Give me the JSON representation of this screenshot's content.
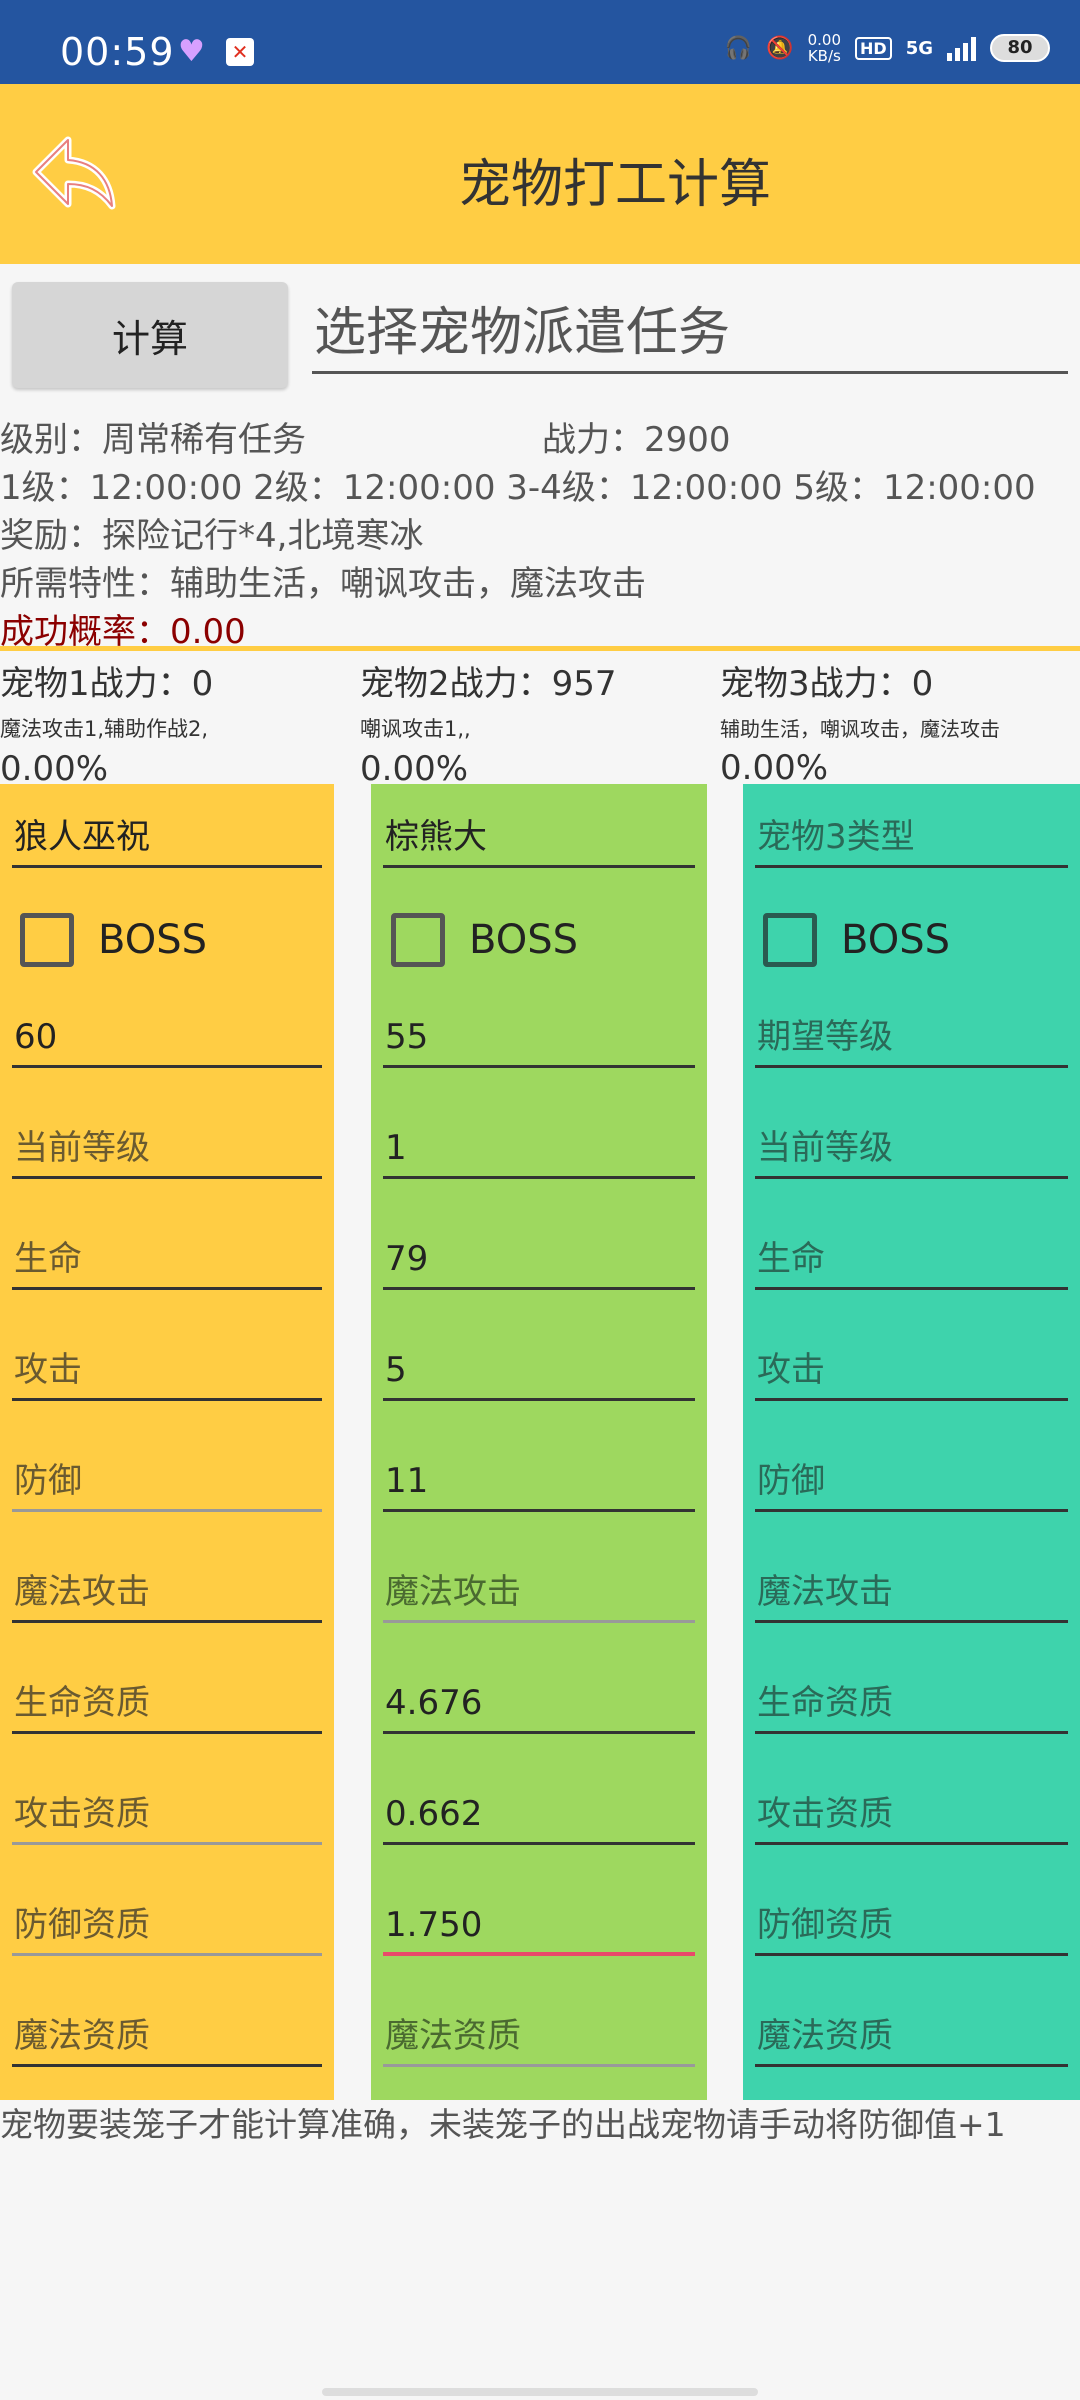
{
  "status": {
    "time": "00:59",
    "net_speed": "0.00",
    "net_unit": "KB/s",
    "hd": "HD",
    "signal": "5G",
    "battery": "80"
  },
  "header": {
    "title": "宠物打工计算"
  },
  "controls": {
    "calc_label": "计算",
    "task_select": "选择宠物派遣任务"
  },
  "info": {
    "level": "级别：周常稀有任务",
    "power": "战力：2900",
    "durations": "1级：12:00:00 2级：12:00:00 3-4级：12:00:00  5级：12:00:00",
    "reward": "奖励：探险记行*4,北境寒冰",
    "traits": "所需特性：辅助生活，嘲讽攻击，魔法攻击",
    "success_label": "成功概率：",
    "success_value": "0.00"
  },
  "pets": [
    {
      "power": "宠物1战力：0",
      "traits": "魔法攻击1,辅助作战2,",
      "pct": "0.00%"
    },
    {
      "power": "宠物2战力：957",
      "traits": "嘲讽攻击1,,",
      "pct": "0.00%"
    },
    {
      "power": "宠物3战力：0",
      "traits": "辅助生活，嘲讽攻击，魔法攻击",
      "pct": "0.00%"
    }
  ],
  "columns": [
    {
      "type": "狼人巫祝",
      "boss_label": "BOSS",
      "fields": [
        "60",
        "当前等级",
        "生命",
        "攻击",
        "防御",
        "魔法攻击",
        "生命资质",
        "攻击资质",
        "防御资质",
        "魔法资质"
      ]
    },
    {
      "type": "棕熊大",
      "boss_label": "BOSS",
      "fields": [
        "55",
        "1",
        "79",
        "5",
        "11",
        "魔法攻击",
        "4.676",
        "0.662",
        "1.750",
        "魔法资质"
      ]
    },
    {
      "type": "宠物3类型",
      "boss_label": "BOSS",
      "fields": [
        "期望等级",
        "当前等级",
        "生命",
        "攻击",
        "防御",
        "魔法攻击",
        "生命资质",
        "攻击资质",
        "防御资质",
        "魔法资质"
      ]
    }
  ],
  "footer": {
    "note": "宠物要装笼子才能计算准确，未装笼子的出战宠物请手动将防御值+1"
  },
  "colors": {
    "accent": "#ffcd44",
    "status_bar": "#2455a0",
    "col1": "#ffcd44",
    "col2": "#9ed85f",
    "col3": "#3ed3ac",
    "danger": "#8b0000",
    "focus": "#e84a6a"
  }
}
